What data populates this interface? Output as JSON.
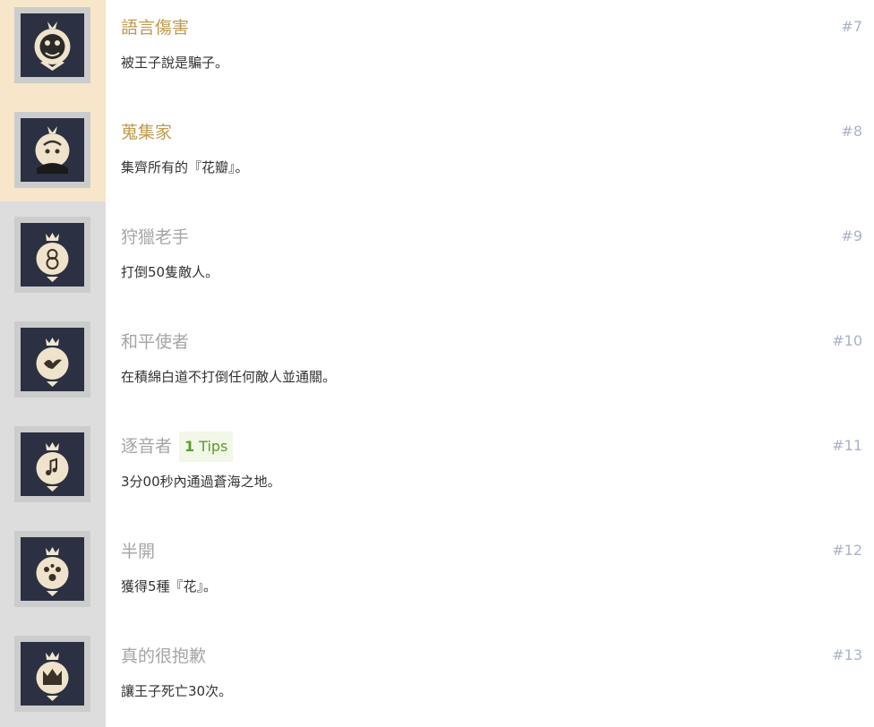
{
  "achievements": [
    {
      "title": "語言傷害",
      "number": "#7",
      "description": "被王子說是騙子。",
      "state": "unlocked",
      "icon": "mask-bear-icon"
    },
    {
      "title": "蒐集家",
      "number": "#8",
      "description": "集齊所有的『花瓣』。",
      "state": "unlocked",
      "icon": "flower-collector-icon"
    },
    {
      "title": "狩獵老手",
      "number": "#9",
      "description": "打倒50隻敵人。",
      "state": "locked",
      "icon": "hunter-icon"
    },
    {
      "title": "和平使者",
      "number": "#10",
      "description": "在積綿白道不打倒任何敵人並通關。",
      "state": "locked",
      "icon": "peace-bird-icon"
    },
    {
      "title": "逐音者",
      "number": "#11",
      "description": "3分00秒內通過蒼海之地。",
      "state": "locked",
      "icon": "music-notes-icon",
      "tips": {
        "count": "1",
        "label": "Tips"
      }
    },
    {
      "title": "半開",
      "number": "#12",
      "description": "獲得5種『花』。",
      "state": "locked",
      "icon": "flowers-icon"
    },
    {
      "title": "真的很抱歉",
      "number": "#13",
      "description": "讓王子死亡30次。",
      "state": "locked",
      "icon": "crown-sorrow-icon"
    }
  ],
  "colors": {
    "unlocked_title": "#c09a4e",
    "locked_title": "#a5a5a5",
    "unlocked_side": "#f7e6ca",
    "locked_side": "#dddddd",
    "badge_bg": "#2b3142",
    "tips_bg": "#f2f7e7",
    "tips_text": "#5c9c2a",
    "number": "#a9b2c8"
  }
}
